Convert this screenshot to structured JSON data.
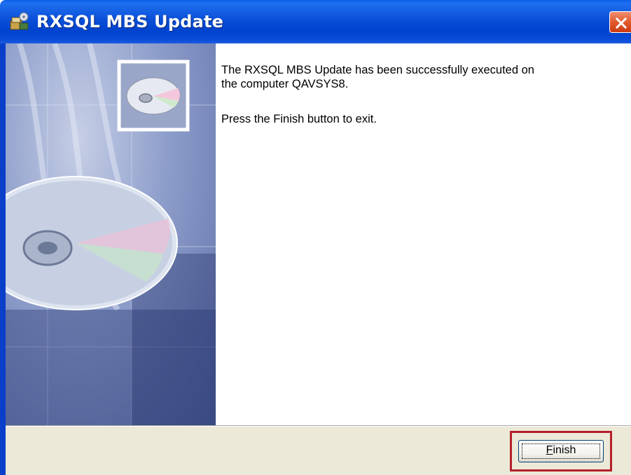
{
  "window": {
    "title": "RXSQL MBS Update",
    "icon": "installer-app-icon",
    "close_icon": "close-icon"
  },
  "content": {
    "message_line_1": "The RXSQL MBS Update has been successfully executed on",
    "message_line_2": "the computer QAVSYS8.",
    "instruction": "Press the Finish button to exit."
  },
  "buttons": {
    "finish_accel": "F",
    "finish_rest": "inish"
  },
  "colors": {
    "titlebar": "#0a4fd8",
    "footer": "#ece9d8",
    "highlight": "#b4202a",
    "close_button": "#e25a2c"
  }
}
